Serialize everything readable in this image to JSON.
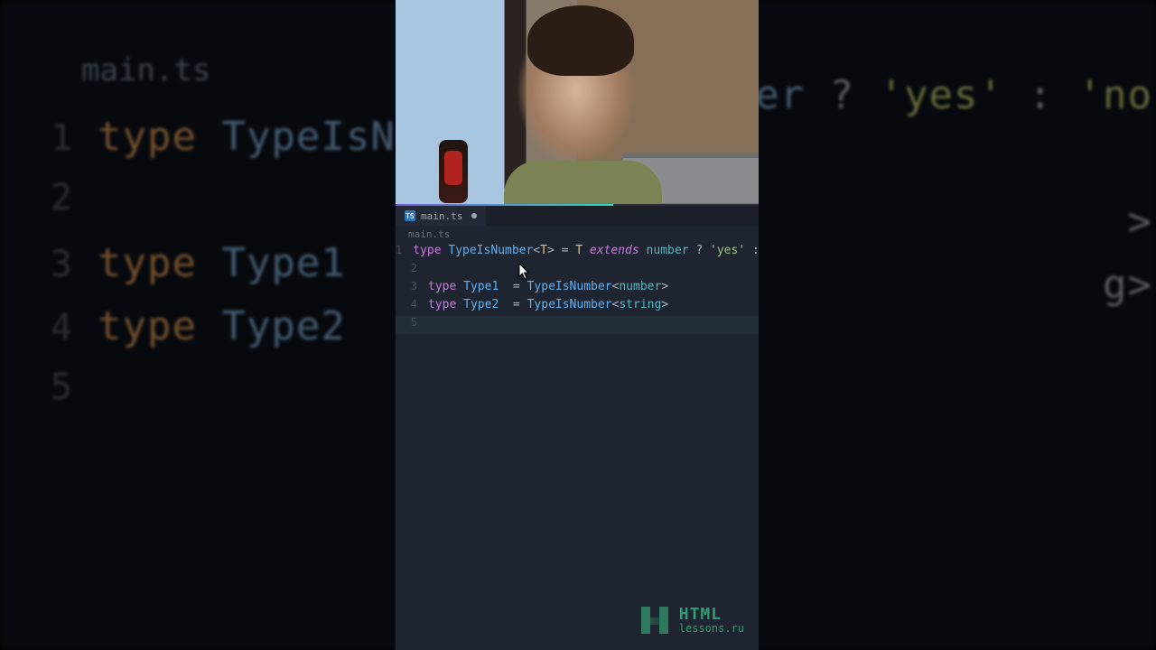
{
  "background_editor": {
    "path_crumb": "main.ts",
    "lines": [
      {
        "n": "1",
        "tokens": [
          {
            "c": "c-kw",
            "t": "type "
          },
          {
            "c": "c-ty",
            "t": "TypeIsNumb"
          }
        ]
      },
      {
        "n": "2",
        "tokens": []
      },
      {
        "n": "3",
        "tokens": [
          {
            "c": "c-kw",
            "t": "type "
          },
          {
            "c": "c-ty",
            "t": "Type1"
          },
          {
            "c": "c-op",
            "t": "   = "
          }
        ]
      },
      {
        "n": "4",
        "tokens": [
          {
            "c": "c-kw",
            "t": "type "
          },
          {
            "c": "c-ty",
            "t": "Type2"
          },
          {
            "c": "c-op",
            "t": "   = "
          }
        ]
      },
      {
        "n": "5",
        "tokens": []
      }
    ],
    "right_fragment": [
      {
        "c": "c-ty",
        "t": "number"
      },
      {
        "c": "c-op",
        "t": " ? "
      },
      {
        "c": "c-str",
        "t": "'yes'"
      },
      {
        "c": "c-op",
        "t": " : "
      },
      {
        "c": "c-str",
        "t": "'no"
      }
    ],
    "right_r3_tail": ">",
    "right_r4_tail": "g>"
  },
  "frame": {
    "tab": {
      "icon_label": "TS",
      "filename": "main.ts"
    },
    "crumb": "main.ts",
    "code": {
      "lines": [
        {
          "n": "1",
          "hl": false,
          "tokens": [
            {
              "c": "s-kw",
              "t": "type "
            },
            {
              "c": "s-ty",
              "t": "TypeIsNumber"
            },
            {
              "c": "s-op",
              "t": "<"
            },
            {
              "c": "s-gn",
              "t": "T"
            },
            {
              "c": "s-op",
              "t": "> = "
            },
            {
              "c": "s-gn",
              "t": "T"
            },
            {
              "c": "s-op",
              "t": " "
            },
            {
              "c": "s-ext",
              "t": "extends"
            },
            {
              "c": "s-op",
              "t": " "
            },
            {
              "c": "s-ty2",
              "t": "number"
            },
            {
              "c": "s-op",
              "t": " ? "
            },
            {
              "c": "s-str",
              "t": "'yes'"
            },
            {
              "c": "s-op",
              "t": " : "
            },
            {
              "c": "s-str",
              "t": "'no"
            }
          ]
        },
        {
          "n": "2",
          "hl": false,
          "tokens": []
        },
        {
          "n": "3",
          "hl": false,
          "tokens": [
            {
              "c": "s-kw",
              "t": "type "
            },
            {
              "c": "s-ty",
              "t": "Type1"
            },
            {
              "c": "s-op",
              "t": "  = "
            },
            {
              "c": "s-ty",
              "t": "TypeIsNumber"
            },
            {
              "c": "s-op",
              "t": "<"
            },
            {
              "c": "s-ty2",
              "t": "number"
            },
            {
              "c": "s-op",
              "t": ">"
            }
          ]
        },
        {
          "n": "4",
          "hl": false,
          "tokens": [
            {
              "c": "s-kw",
              "t": "type "
            },
            {
              "c": "s-ty",
              "t": "Type2"
            },
            {
              "c": "s-op",
              "t": "  = "
            },
            {
              "c": "s-ty",
              "t": "TypeIsNumber"
            },
            {
              "c": "s-op",
              "t": "<"
            },
            {
              "c": "s-ty2",
              "t": "string"
            },
            {
              "c": "s-op",
              "t": ">"
            }
          ]
        },
        {
          "n": "5",
          "hl": true,
          "tokens": []
        }
      ]
    }
  },
  "watermark": {
    "brand": "HTML",
    "site": "lessons.ru"
  }
}
